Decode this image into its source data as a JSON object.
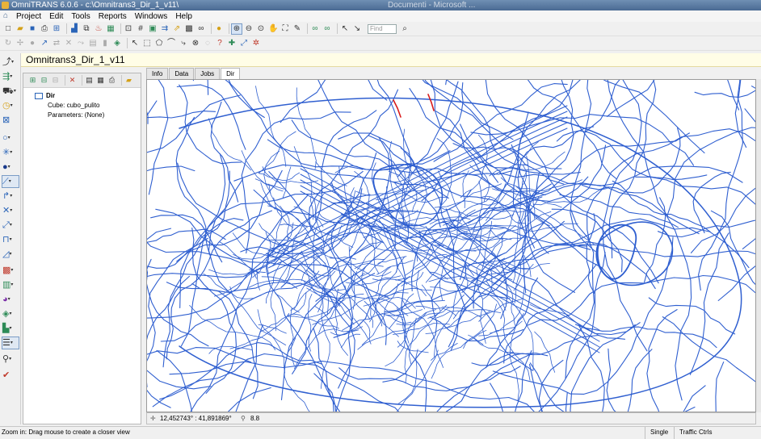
{
  "window": {
    "title": "OmniTRANS 6.0.6 - c:\\Omnitrans3_Dir_1_v11\\",
    "background_title": "Documenti - Microsoft ..."
  },
  "menu": [
    "Project",
    "Edit",
    "Tools",
    "Reports",
    "Windows",
    "Help"
  ],
  "toolbar": {
    "find_placeholder": "Find"
  },
  "project": {
    "title": "Omnitrans3_Dir_1_v11"
  },
  "tree": {
    "root": "Dir",
    "cube": "Cube: cubo_pulito",
    "parameters": "Parameters: (None)"
  },
  "tabs": [
    {
      "label": "Info"
    },
    {
      "label": "Data"
    },
    {
      "label": "Jobs"
    },
    {
      "label": "Dir",
      "selected": true
    }
  ],
  "map_status": {
    "coordinates": "12,452743° : 41,891869°",
    "zoom": "8.8"
  },
  "status": {
    "hint": "Zoom in: Drag mouse to create a closer view",
    "mode": "Single",
    "panel": "Traffic Ctrls"
  },
  "colors": {
    "network": "#2f5fd0",
    "highlight": "#d81b1b",
    "project_bar": "#fffde6"
  }
}
